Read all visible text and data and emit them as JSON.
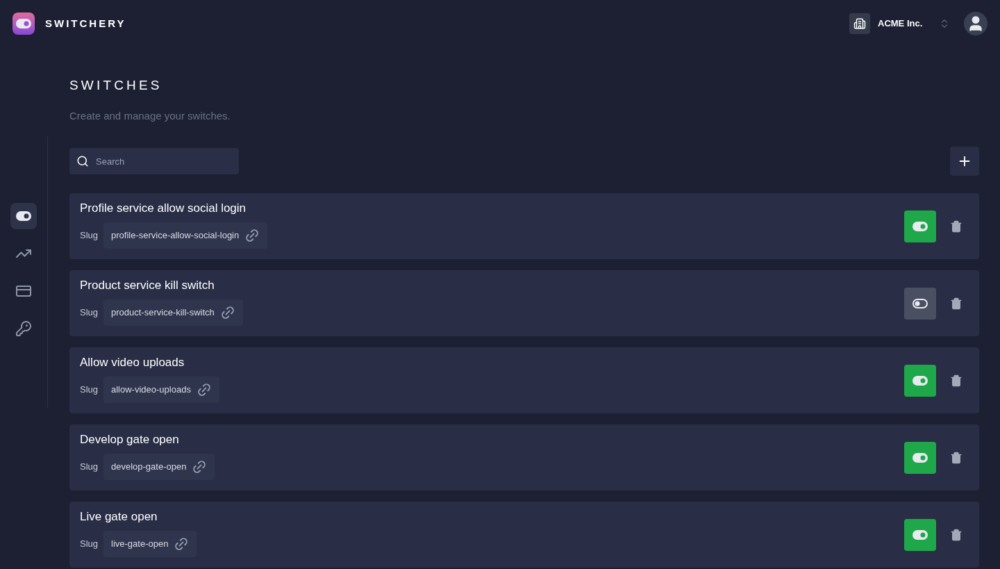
{
  "brand": {
    "name": "SWITCHERY"
  },
  "org": {
    "name": "ACME Inc."
  },
  "sidebar": {
    "items": [
      {
        "kind": "toggle",
        "selected": true
      },
      {
        "kind": "chart",
        "selected": false
      },
      {
        "kind": "card",
        "selected": false
      },
      {
        "kind": "key",
        "selected": false
      }
    ]
  },
  "page": {
    "title": "SWITCHES",
    "subtitle": "Create and manage your switches."
  },
  "search": {
    "placeholder": "Search"
  },
  "switches": [
    {
      "name": "Profile service allow social login",
      "slug_label": "Slug",
      "slug": "profile-service-allow-social-login",
      "on": true
    },
    {
      "name": "Product service kill switch",
      "slug_label": "Slug",
      "slug": "product-service-kill-switch",
      "on": false
    },
    {
      "name": "Allow video uploads",
      "slug_label": "Slug",
      "slug": "allow-video-uploads",
      "on": true
    },
    {
      "name": "Develop gate open",
      "slug_label": "Slug",
      "slug": "develop-gate-open",
      "on": true
    },
    {
      "name": "Live gate open",
      "slug_label": "Slug",
      "slug": "live-gate-open",
      "on": true
    }
  ]
}
